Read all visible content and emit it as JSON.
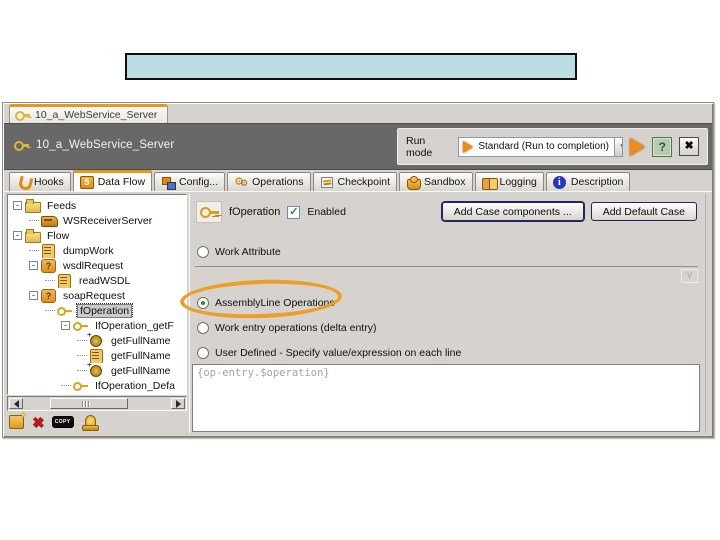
{
  "slide": {
    "title_text": ""
  },
  "window": {
    "doc_tab_label": "10_a_WebService_Server",
    "header": {
      "title": "10_a_WebService_Server",
      "run_mode_label": "Run mode",
      "run_mode_value": "Standard (Run to completion)",
      "chevron": "∨"
    },
    "tabs": [
      {
        "label": "Hooks",
        "icon": "hook",
        "selected": false
      },
      {
        "label": "Data Flow",
        "icon": "dataflow",
        "selected": true
      },
      {
        "label": "Config...",
        "icon": "config",
        "selected": false
      },
      {
        "label": "Operations",
        "icon": "operations",
        "selected": false
      },
      {
        "label": "Checkpoint",
        "icon": "checkpoint",
        "selected": false
      },
      {
        "label": "Sandbox",
        "icon": "sandbox",
        "selected": false
      },
      {
        "label": "Logging",
        "icon": "logging",
        "selected": false
      },
      {
        "label": "Description",
        "icon": "description",
        "selected": false
      }
    ],
    "tree": {
      "items": [
        {
          "label": "Feeds",
          "level": 0,
          "icon": "folder",
          "expander": true,
          "selected": false
        },
        {
          "label": "WSReceiverServer",
          "level": 1,
          "icon": "connector",
          "expander": false,
          "selected": false
        },
        {
          "label": "Flow",
          "level": 0,
          "icon": "folder",
          "expander": true,
          "selected": false
        },
        {
          "label": "dumpWork",
          "level": 1,
          "icon": "script",
          "expander": false,
          "selected": false
        },
        {
          "label": "wsdlRequest",
          "level": 1,
          "icon": "choice",
          "expander": true,
          "selected": false
        },
        {
          "label": "readWSDL",
          "level": 2,
          "icon": "script",
          "expander": false,
          "selected": false
        },
        {
          "label": "soapRequest",
          "level": 1,
          "icon": "choice",
          "expander": true,
          "selected": false
        },
        {
          "label": "fOperation",
          "level": 2,
          "icon": "switch",
          "expander": false,
          "selected": true
        },
        {
          "label": "IfOperation_getF",
          "level": 3,
          "icon": "case",
          "expander": true,
          "selected": false
        },
        {
          "label": "getFullName",
          "level": 4,
          "icon": "func",
          "expander": false,
          "selected": false
        },
        {
          "label": "getFullName",
          "level": 4,
          "icon": "script",
          "expander": false,
          "selected": false
        },
        {
          "label": "getFullName",
          "level": 4,
          "icon": "func",
          "expander": false,
          "selected": false
        },
        {
          "label": "IfOperation_Defa",
          "level": 3,
          "icon": "case",
          "expander": false,
          "selected": false
        }
      ]
    },
    "tree_toolbar": [
      {
        "name": "new-component",
        "icon": "new"
      },
      {
        "name": "delete",
        "icon": "delete",
        "glyph": "✖"
      },
      {
        "name": "copy",
        "icon": "copy",
        "glyph": "COPY"
      },
      {
        "name": "component",
        "icon": "bell"
      }
    ],
    "panel": {
      "component_name": "fOperation",
      "enabled_label": "Enabled",
      "enabled_checked": "✓",
      "buttons": [
        "Add Case components ...",
        "Add Default Case"
      ],
      "radios": [
        {
          "label": "Work Attribute",
          "selected": false,
          "annotated": false
        },
        {
          "label": "AssemblyLine Operations",
          "selected": true,
          "annotated": true
        },
        {
          "label": "Work entry operations (delta entry)",
          "selected": false,
          "annotated": false
        },
        {
          "label": "User Defined - Specify value/expression on each line",
          "selected": false,
          "annotated": false
        }
      ],
      "expression_text": "{op-entry.$operation}"
    }
  },
  "colors": {
    "accent_orange": "#e8971d",
    "annotation_orange": "#ec9f28",
    "title_box_fill": "#bcdde2",
    "header_gray": "#686868",
    "window_gray": "#d6d3ce",
    "selection_green": "#2e8b2e"
  }
}
